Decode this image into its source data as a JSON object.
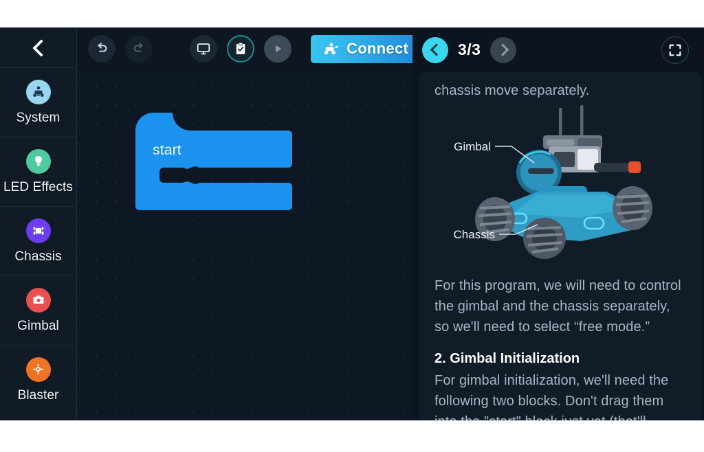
{
  "sidebar": {
    "back_icon": "chevron-left-icon",
    "items": [
      {
        "label": "System",
        "icon": "robot-icon",
        "color": "#9cd5f0"
      },
      {
        "label": "LED Effects",
        "icon": "led-icon",
        "color": "#4ec9a0"
      },
      {
        "label": "Chassis",
        "icon": "chassis-icon",
        "color": "#6d3cf0"
      },
      {
        "label": "Gimbal",
        "icon": "camera-icon",
        "color": "#e8514f"
      },
      {
        "label": "Blaster",
        "icon": "blaster-icon",
        "color": "#ef7323"
      }
    ]
  },
  "toolbar": {
    "undo_label": "Undo",
    "redo_label": "Redo",
    "monitor_label": "Monitor",
    "checklist_label": "Tasks",
    "play_label": "Run",
    "connect_label": "Connect",
    "connect_color": "#2fb0e8"
  },
  "canvas": {
    "blocks": [
      {
        "label": "start",
        "color": "#1b92ed",
        "type": "hat-c-block"
      }
    ]
  },
  "right_panel": {
    "page_counter": "3/3",
    "prev_label": "Previous",
    "next_label": "Next",
    "fullscreen_label": "Fullscreen",
    "prev_color": "#3bd7ee",
    "tutorial": {
      "lead_line": "chassis move separately.",
      "figure": {
        "alt": "RoboMaster S1 robot diagram",
        "labels": [
          "Gimbal",
          "Chassis"
        ]
      },
      "paragraph_1": "For this program, we will need to control the gimbal and the chassis separately, so we'll need to select “free mode.”",
      "heading_2": "2. Gimbal Initialization",
      "paragraph_2": "For gimbal initialization, we'll need the following two blocks. Don't drag them into the \"start\" block just yet (that'll"
    }
  }
}
